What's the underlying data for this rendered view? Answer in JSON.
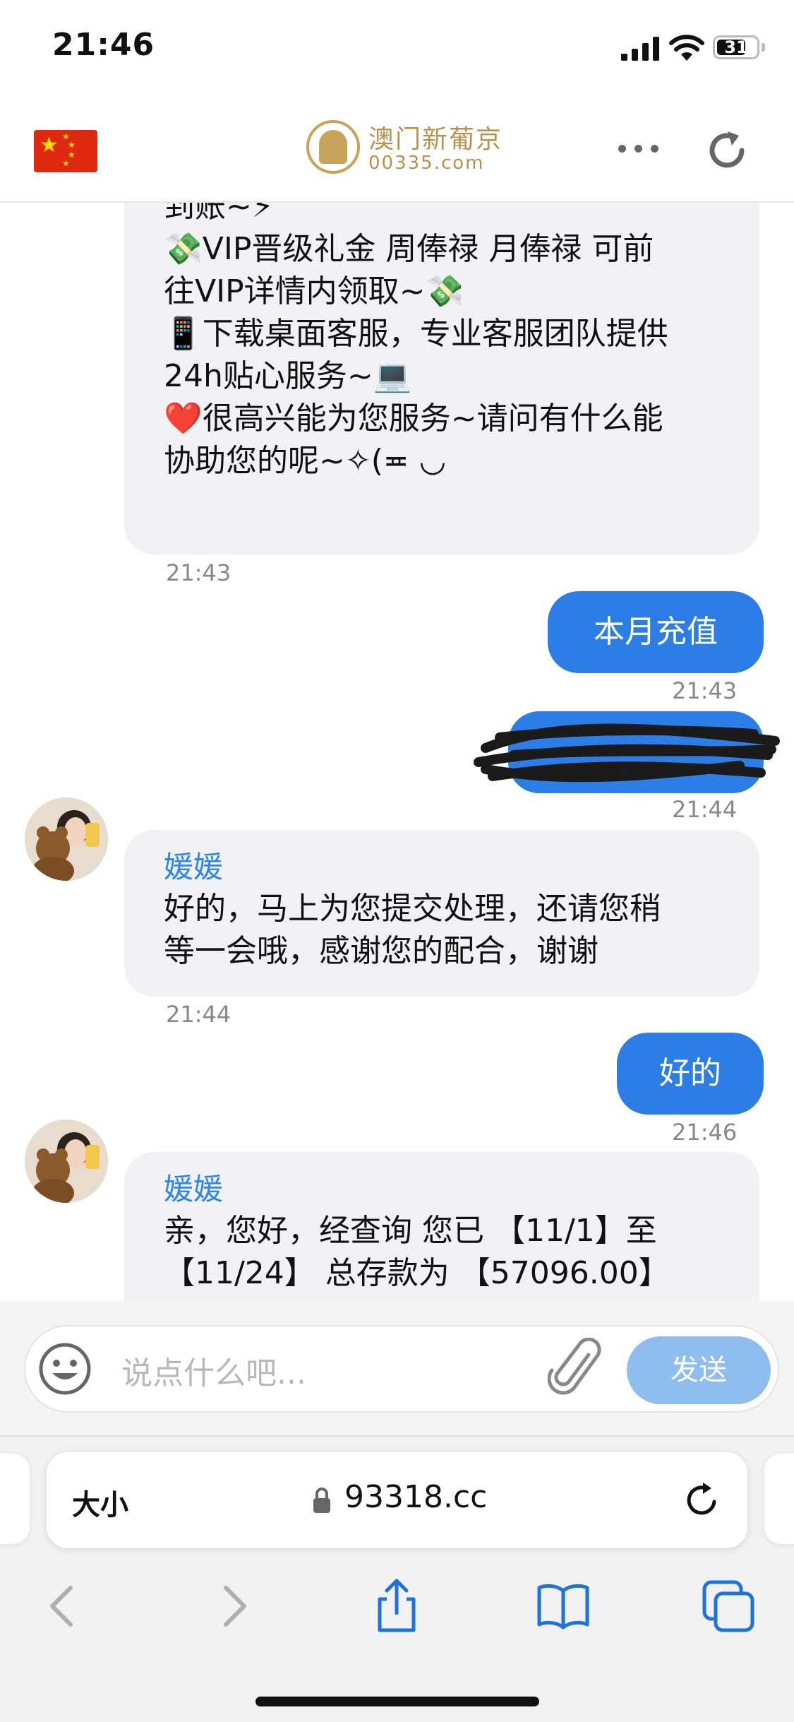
{
  "status_bar": {
    "time": "21:46",
    "battery": "31"
  },
  "header": {
    "logo_cn": "澳门新葡京",
    "logo_en": "00335.com"
  },
  "messages": {
    "m1": {
      "lines": [
        "到账~⚡",
        "💸VIP晋级礼金  周俸禄 月俸禄 可前",
        "往VIP详情内领取~💸",
        "📱下载桌面客服，专业客服团队提供",
        "24h贴心服务~💻",
        "❤️很高兴能为您服务~请问有什么能",
        "协助您的呢~✧(≖ ◡"
      ],
      "time": "21:43"
    },
    "m2": {
      "text": "本月充值",
      "time": "21:43"
    },
    "m3": {
      "time": "21:44"
    },
    "m4": {
      "sender": "媛媛",
      "lines": [
        "好的，马上为您提交处理，还请您稍",
        "等一会哦，感谢您的配合，谢谢"
      ],
      "time": "21:44"
    },
    "m5": {
      "text": "好的",
      "time": "21:46"
    },
    "m6": {
      "sender": "媛媛",
      "lines": [
        " 亲，您好，经查询 您已 【11/1】至",
        "【11/24】 总存款为 【57096.00】"
      ]
    }
  },
  "input": {
    "placeholder": "说点什么吧...",
    "send_label": "发送"
  },
  "browser": {
    "text_size_label": "大小",
    "url": "93318.cc"
  }
}
